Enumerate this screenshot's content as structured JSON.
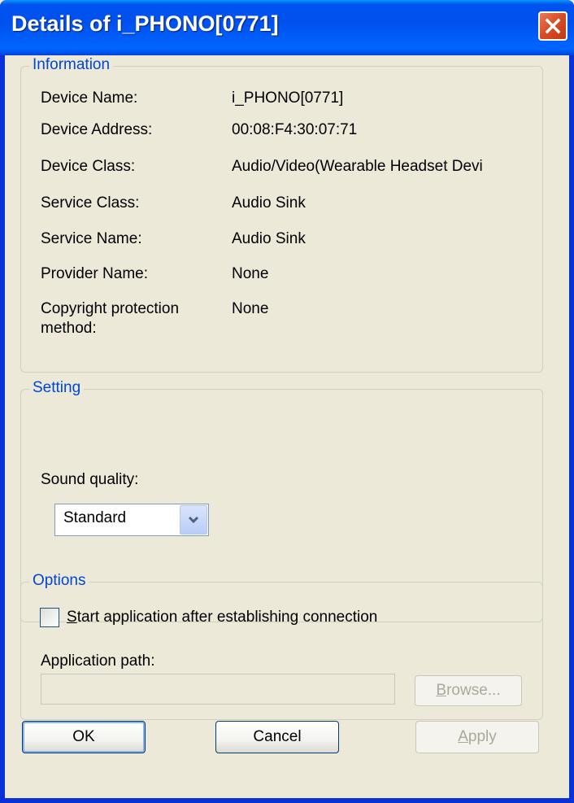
{
  "window": {
    "title": "Details of i_PHONO[0771]"
  },
  "information": {
    "title": "Information",
    "rows": [
      {
        "label": "Device Name:",
        "value": "i_PHONO[0771]"
      },
      {
        "label": "Device Address:",
        "value": "00:08:F4:30:07:71"
      },
      {
        "label": "Device Class:",
        "value": "Audio/Video(Wearable Headset Devi"
      },
      {
        "label": "Service Class:",
        "value": "Audio Sink"
      },
      {
        "label": "Service Name:",
        "value": "Audio Sink"
      },
      {
        "label": "Provider Name:",
        "value": "None"
      },
      {
        "label_line1": "Copyright protection",
        "label_line2": "method:",
        "value": "None"
      }
    ]
  },
  "setting": {
    "title": "Setting",
    "sound_quality_label": "Sound quality:",
    "sound_quality_value": "Standard"
  },
  "options": {
    "title": "Options",
    "start_app_label": "Start application after establishing connection",
    "start_app_checked": false,
    "app_path_label": "Application path:",
    "app_path_value": "",
    "browse_label": "Browse..."
  },
  "buttons": {
    "ok": "OK",
    "cancel": "Cancel",
    "apply": "Apply"
  },
  "colors": {
    "titlebar": "#0054e3",
    "group_title": "#0046d5",
    "face": "#ece9d8",
    "close": "#d84a25"
  }
}
